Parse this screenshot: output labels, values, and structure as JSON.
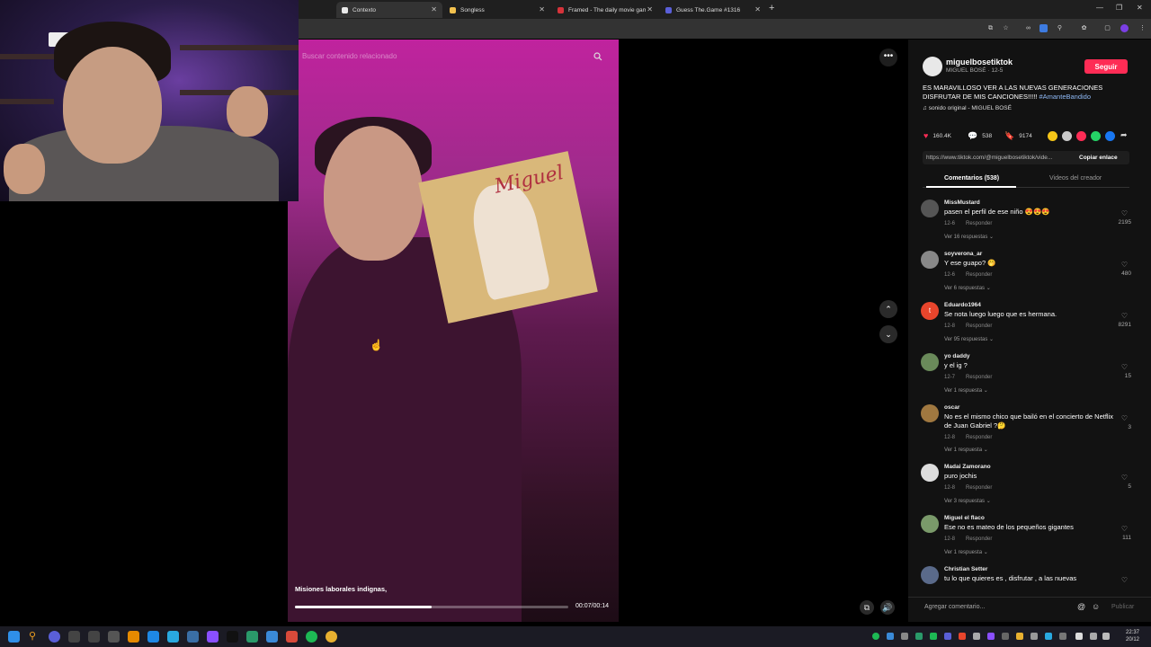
{
  "browser": {
    "tabs": [
      {
        "title": "Contexto",
        "color": "#e9e9e9"
      },
      {
        "title": "Songless",
        "color": "#f2c14e"
      },
      {
        "title": "Framed - The daily movie game",
        "color": "#d6333a"
      },
      {
        "title": "Guess The.Game #1316",
        "color": "#5a5fd8"
      }
    ]
  },
  "video": {
    "search_placeholder": "Buscar contenido relacionado",
    "caption": "Misiones laborales indignas,",
    "timecode": "00:07/00:14",
    "progress": 0.5,
    "album_title": "Miguel"
  },
  "post": {
    "author": "miguelbosetiktok",
    "author_sub": "MIGUEL BOSÉ · 12-5",
    "follow_label": "Seguir",
    "description": "ES MARAVILLOSO VER A LAS NUEVAS GENERACIONES DISFRUTAR DE MIS CANCIONES!!!!! ",
    "hashtag": "#AmanteBandido",
    "music": "sonido original - MIGUEL BOSÉ",
    "likes": "160.4K",
    "comments": "538",
    "saves": "9174",
    "link": "https://www.tiktok.com/@miguelbosetiktok/vide...",
    "copy_link": "Copiar enlace",
    "tab_comments": "Comentarios (538)",
    "tab_creator": "Videos del creador",
    "share_colors": [
      "#f5c518",
      "#c9c9c9",
      "#fe2c55",
      "#25d366",
      "#1877f2"
    ]
  },
  "comments": [
    {
      "name": "MissMustard",
      "text": "pasen el perfil de ese niño 😍😍😍",
      "date": "12-6",
      "reply": "Responder",
      "replies": "Ver 16 respuestas ⌄",
      "likes": "2195",
      "color": "#555"
    },
    {
      "name": "soyverona_ar",
      "text": "Y ese guapo? 🤭",
      "date": "12-6",
      "reply": "Responder",
      "replies": "Ver 6 respuestas ⌄",
      "likes": "480",
      "color": "#888"
    },
    {
      "name": "Eduardo1964",
      "text": "Se nota luego luego que es hermana.",
      "date": "12-8",
      "reply": "Responder",
      "replies": "Ver 95 respuestas ⌄",
      "likes": "8291",
      "color": "#e8452c"
    },
    {
      "name": "yo daddy",
      "text": "y el ig ?",
      "date": "12-7",
      "reply": "Responder",
      "replies": "Ver 1 respuesta ⌄",
      "likes": "15",
      "color": "#6a8a5a"
    },
    {
      "name": "oscar",
      "text": "No es el mismo chico que bailó en el concierto de Netflix de Juan Gabriel ?🤔",
      "date": "12-8",
      "reply": "Responder",
      "replies": "Ver 1 respuesta ⌄",
      "likes": "3",
      "color": "#a07840"
    },
    {
      "name": "Madai Zamorano",
      "text": "puro jochis",
      "date": "12-8",
      "reply": "Responder",
      "replies": "Ver 3 respuestas ⌄",
      "likes": "5",
      "color": "#ddd"
    },
    {
      "name": "Miguel el flaco",
      "text": "Ese no es mateo de los pequeños gigantes",
      "date": "12-8",
      "reply": "Responder",
      "replies": "Ver 1 respuesta ⌄",
      "likes": "111",
      "color": "#7a9a6a"
    },
    {
      "name": "Christian Setter",
      "text": "tu lo que quieres es , disfrutar , a las nuevas",
      "date": "",
      "reply": "",
      "replies": "",
      "likes": "",
      "color": "#5a6a8a"
    }
  ],
  "add_comment": {
    "placeholder": "Agregar comentario...",
    "publish": "Publicar"
  },
  "taskbar": {
    "time": "22:37",
    "date": "20/12"
  }
}
